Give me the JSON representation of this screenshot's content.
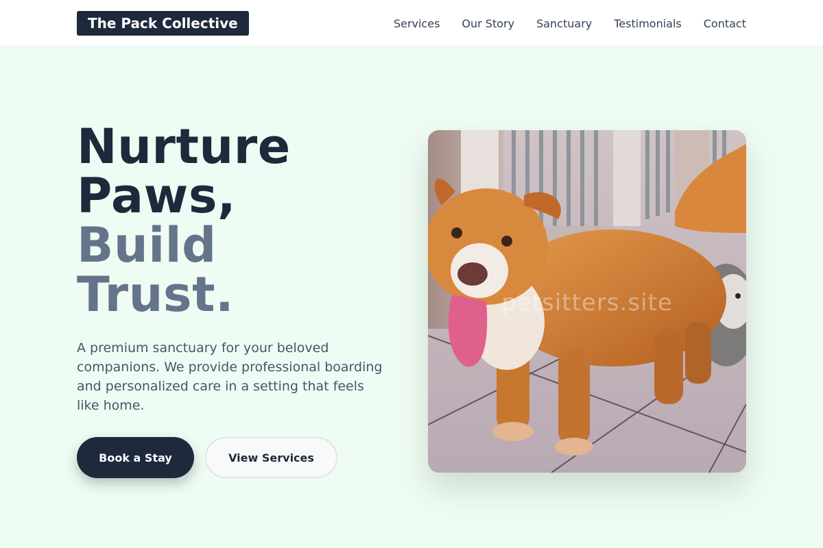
{
  "brand": {
    "name": "The Pack Collective"
  },
  "nav": {
    "items": [
      "Services",
      "Our Story",
      "Sanctuary",
      "Testimonials",
      "Contact"
    ]
  },
  "hero": {
    "headline_line1": "Nurture",
    "headline_line2": "Paws,",
    "headline_line3": "Build",
    "headline_line4": "Trust.",
    "description": "A premium sanctuary for your beloved companions. We provide professional boarding and personalized care in a setting that feels like home.",
    "primary_button": "Book a Stay",
    "secondary_button": "View Services"
  },
  "image": {
    "subject": "dog-photo",
    "watermark": "petsitters.site"
  },
  "colors": {
    "background": "#effcf3",
    "navy": "#1e293b",
    "slate": "#64748b",
    "body_text": "#475569"
  }
}
